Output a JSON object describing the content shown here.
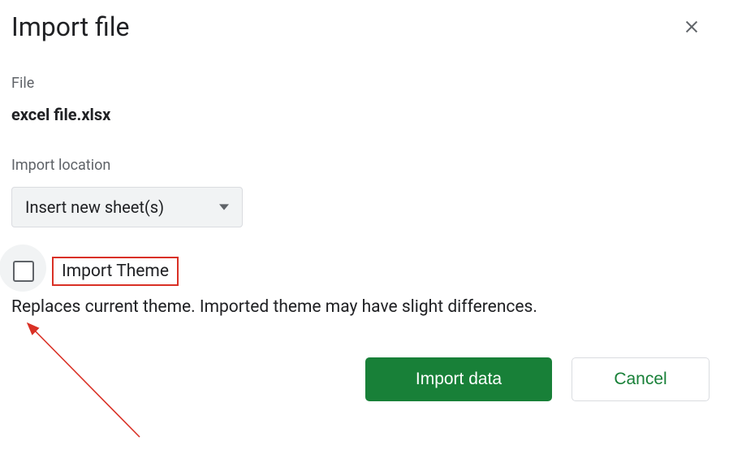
{
  "dialog": {
    "title": "Import file",
    "file_label": "File",
    "file_name": "excel file.xlsx",
    "location_label": "Import location",
    "location_value": "Insert new sheet(s)",
    "checkbox_label": "Import Theme",
    "description": "Replaces current theme. Imported theme may have slight differences.",
    "primary_button": "Import data",
    "secondary_button": "Cancel"
  }
}
